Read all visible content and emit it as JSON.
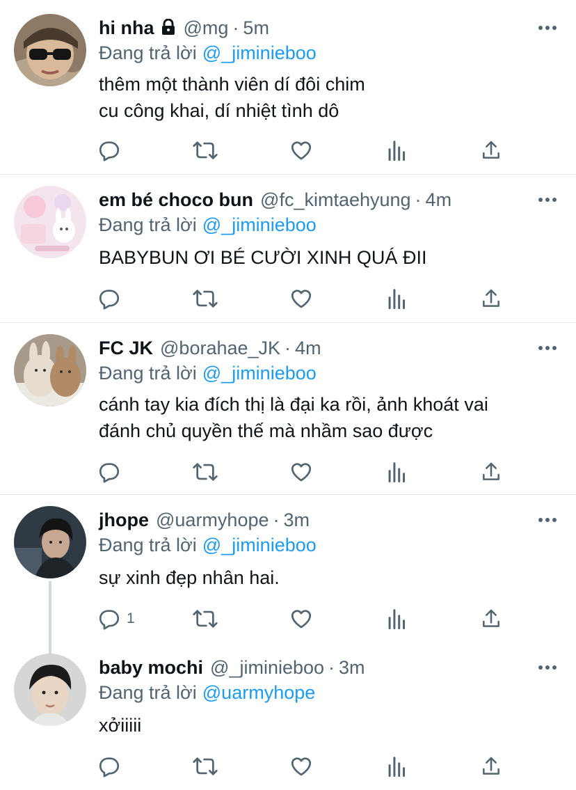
{
  "colors": {
    "accent": "#1d9bf0",
    "secondary": "#536471",
    "text": "#0f1419"
  },
  "tweets": [
    {
      "name": "hi nha",
      "locked": true,
      "handle": "@mg",
      "dot": "·",
      "time": "5m",
      "reply_prefix": "Đang trả lời",
      "reply_to": "@_jiminieboo",
      "text": "thêm một thành viên dí đôi chim\ncu công khai, dí nhiệt tình dô",
      "reply_count": ""
    },
    {
      "name": "em bé choco bun",
      "handle": "@fc_kimtaehyung",
      "dot": "·",
      "time": "4m",
      "reply_prefix": "Đang trả lời",
      "reply_to": "@_jiminieboo",
      "text": "BABYBUN ƠI BÉ CƯỜI XINH QUÁ ĐII",
      "reply_count": ""
    },
    {
      "name": "FC JK",
      "handle": "@borahae_JK",
      "dot": "·",
      "time": "4m",
      "reply_prefix": "Đang trả lời",
      "reply_to": "@_jiminieboo",
      "text": "cánh tay kia đích thị là đại ka rồi, ảnh khoát vai\nđánh chủ quyền thế mà nhầm sao được",
      "reply_count": ""
    },
    {
      "name": "jhope",
      "handle": "@uarmyhope",
      "dot": "·",
      "time": "3m",
      "reply_prefix": "Đang trả lời",
      "reply_to": "@_jiminieboo",
      "text": "sự xinh đẹp nhân hai.",
      "reply_count": "1"
    },
    {
      "name": "baby mochi",
      "handle": "@_jiminieboo",
      "dot": "·",
      "time": "3m",
      "reply_prefix": "Đang trả lời",
      "reply_to": "@uarmyhope",
      "text": "xởiiiii",
      "reply_count": ""
    }
  ],
  "icons": {
    "reply": "reply-icon",
    "retweet": "retweet-icon",
    "like": "heart-icon",
    "views": "analytics-icon",
    "share": "share-icon",
    "more": "more-icon",
    "lock": "lock-icon"
  }
}
